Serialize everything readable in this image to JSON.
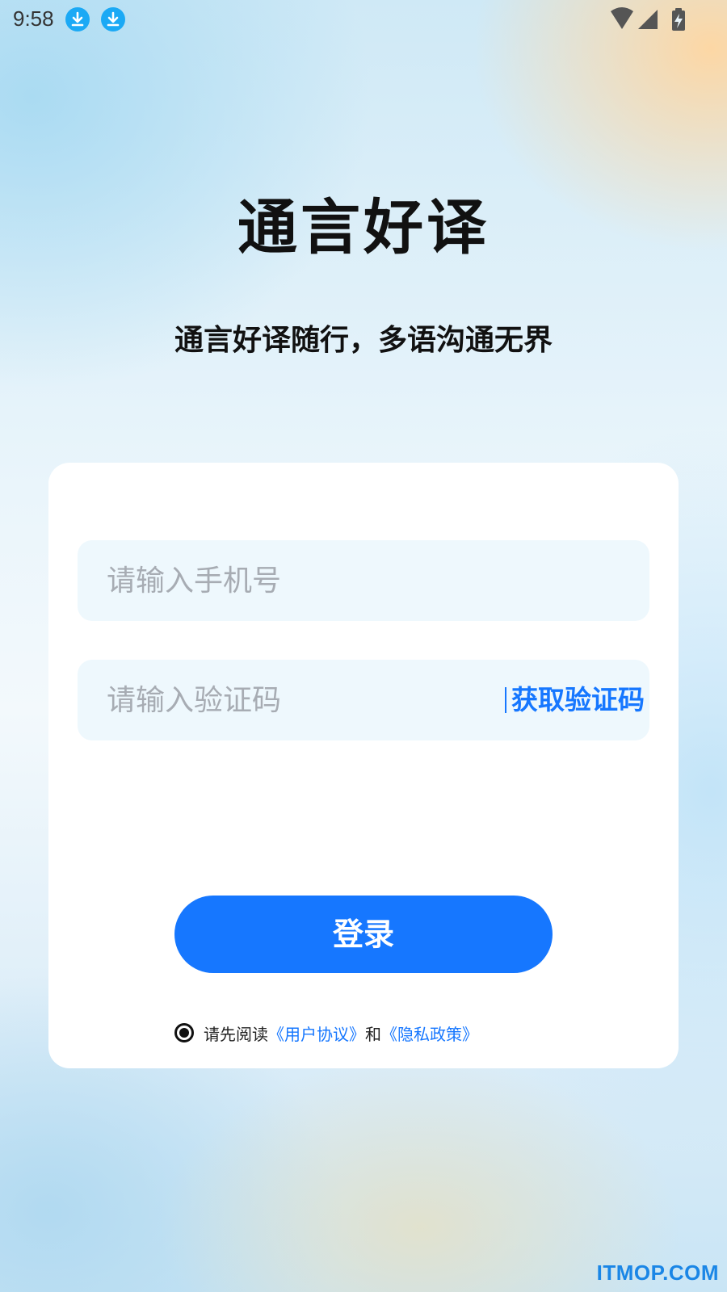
{
  "status_bar": {
    "time": "9:58",
    "icons": [
      "download-icon",
      "download-icon",
      "wifi-icon",
      "cell-signal-icon",
      "battery-charging-icon"
    ]
  },
  "app": {
    "title": "通言好译",
    "slogan": "通言好译随行，多语沟通无界"
  },
  "form": {
    "phone_placeholder": "请输入手机号",
    "code_placeholder": "请输入验证码",
    "get_code_label": "获取验证码",
    "login_label": "登录"
  },
  "agreement": {
    "prefix": "请先阅读",
    "user_agreement": "《用户协议》",
    "conjunction": "和",
    "privacy_policy": "《隐私政策》",
    "checked": true
  },
  "watermark": "ITMOP.COM",
  "colors": {
    "accent": "#1677ff",
    "download_badge": "#1ba9f5",
    "input_bg": "#eef8fd"
  }
}
